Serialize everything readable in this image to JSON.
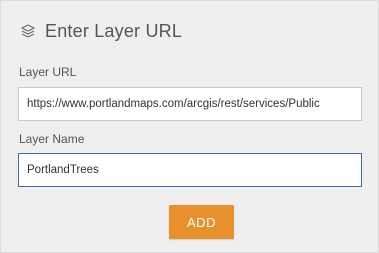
{
  "panel": {
    "title": "Enter Layer URL",
    "title_icon": "layers-icon"
  },
  "layer_url": {
    "label": "Layer URL",
    "value": "https://www.portlandmaps.com/arcgis/rest/services/Public"
  },
  "layer_name": {
    "label": "Layer Name",
    "value": "PortlandTrees"
  },
  "actions": {
    "add_label": "ADD"
  },
  "colors": {
    "panel_background": "#efefef",
    "accent_button": "#e8912c",
    "focused_border": "#3e6fa8"
  }
}
